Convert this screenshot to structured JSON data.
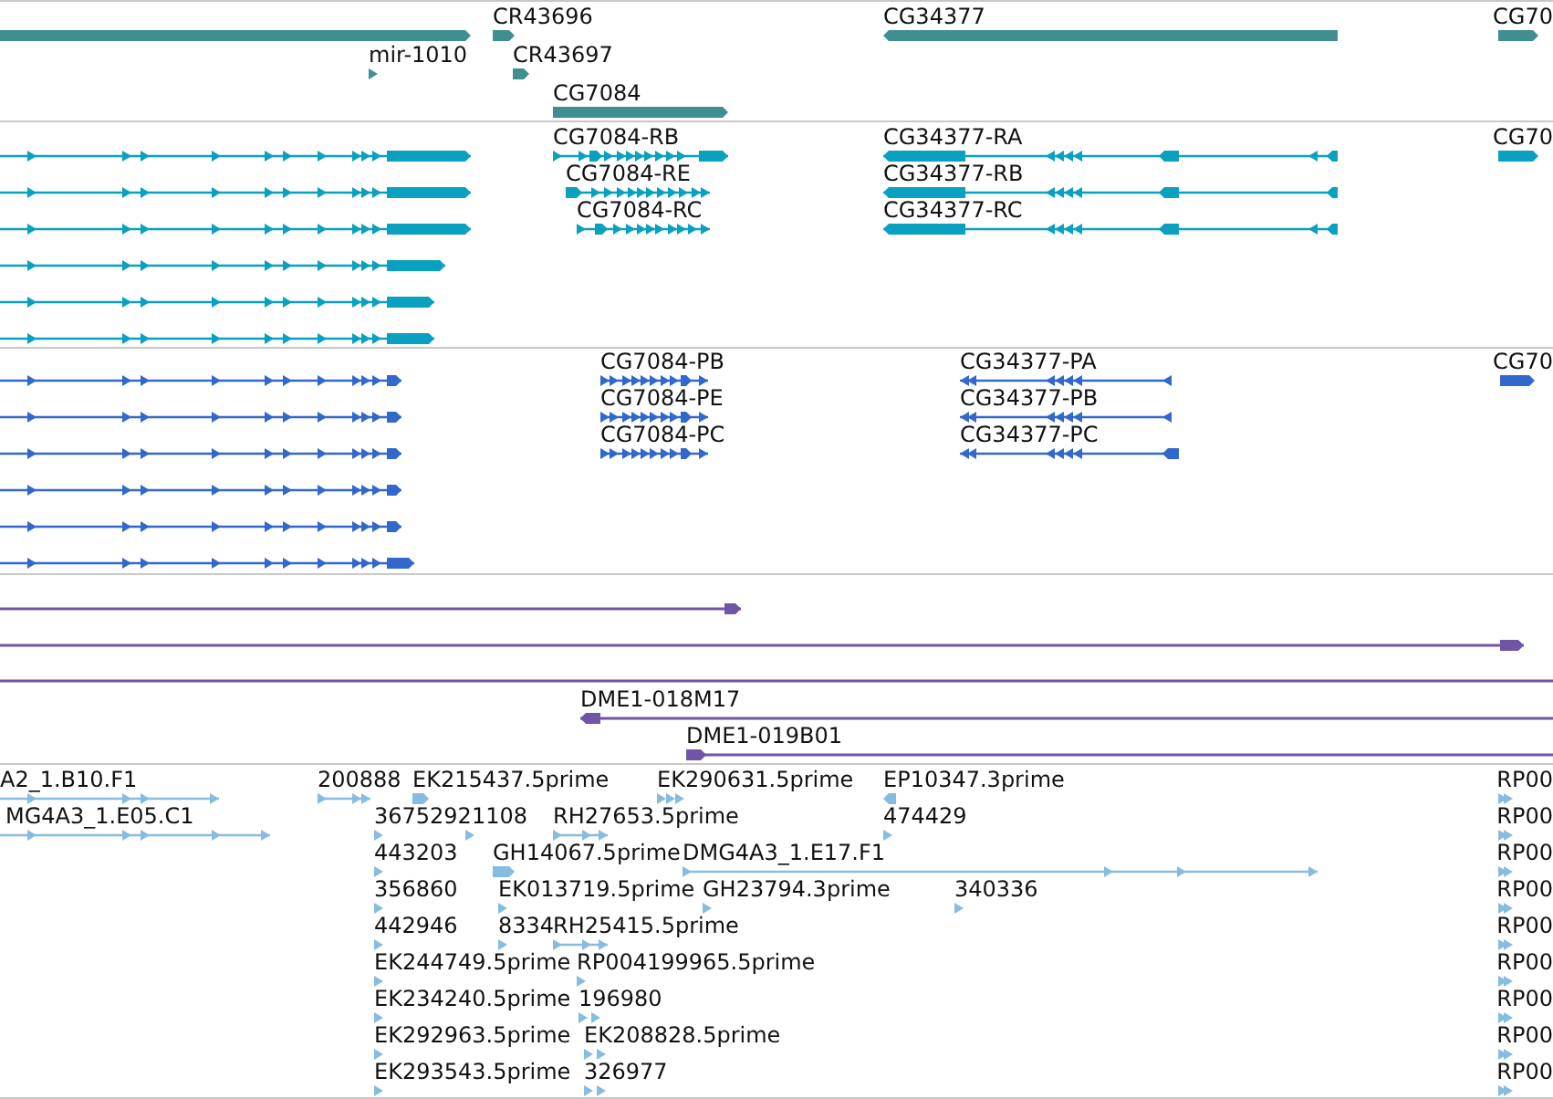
{
  "tracks": [
    {
      "kind": "gene",
      "features": [
        {
          "reverse": false
        },
        {
          "label": "CR43696",
          "reverse": false
        },
        {
          "label": "CG34377",
          "reverse": true
        },
        {
          "label": "CG70",
          "reverse": false
        },
        {
          "label": "mir-1010",
          "reverse": false
        },
        {
          "label": "CR43697",
          "reverse": false
        },
        {
          "label": "CG7084",
          "reverse": false
        }
      ]
    },
    {
      "kind": "transcript",
      "features": [
        {
          "reverse": false
        },
        {
          "label": "CG7084-RB",
          "reverse": false
        },
        {
          "label": "CG34377-RA",
          "reverse": true
        },
        {
          "label": "CG70",
          "reverse": false
        },
        {
          "reverse": false
        },
        {
          "label": "CG7084-RE",
          "reverse": false
        },
        {
          "label": "CG34377-RB",
          "reverse": true
        },
        {
          "reverse": false
        },
        {
          "label": "CG7084-RC",
          "reverse": false
        },
        {
          "label": "CG34377-RC",
          "reverse": true
        },
        {
          "reverse": false
        },
        {
          "reverse": false
        },
        {
          "reverse": false
        }
      ]
    },
    {
      "kind": "protein",
      "features": [
        {
          "reverse": false
        },
        {
          "label": "CG7084-PB",
          "reverse": false
        },
        {
          "label": "CG34377-PA",
          "reverse": true
        },
        {
          "label": "CG70",
          "reverse": false
        },
        {
          "reverse": false
        },
        {
          "label": "CG7084-PE",
          "reverse": false
        },
        {
          "label": "CG34377-PB",
          "reverse": true
        },
        {
          "reverse": false
        },
        {
          "label": "CG7084-PC",
          "reverse": false
        },
        {
          "label": "CG34377-PC",
          "reverse": true
        },
        {
          "reverse": false
        },
        {
          "reverse": false
        },
        {
          "reverse": false
        }
      ]
    },
    {
      "kind": "clone",
      "features": [
        {
          "kind": "arrow",
          "reverse": false
        },
        {
          "kind": "arrow",
          "reverse": false
        },
        {
          "kind": "span"
        },
        {
          "kind": "arrow",
          "label": "DME1-018M17",
          "reverse": true
        },
        {
          "kind": "arrow",
          "label": "DME1-019B01",
          "reverse": false
        }
      ]
    },
    {
      "kind": "est",
      "features": [
        {
          "label": "A2_1.B10.F1",
          "reverse": false
        },
        {
          "label": "200888",
          "reverse": false
        },
        {
          "label": "EK215437.5prime",
          "reverse": false
        },
        {
          "label": "EK290631.5prime",
          "reverse": false
        },
        {
          "label": "EP10347.3prime",
          "reverse": true
        },
        {
          "label": "RP00",
          "reverse": false
        },
        {
          "label": "MG4A3_1.E05.C1",
          "reverse": false
        },
        {
          "label": "36752921108",
          "reverse": false
        },
        {
          "reverse": false
        },
        {
          "label": "RH27653.5prime",
          "reverse": false
        },
        {
          "label": "474429",
          "reverse": false
        },
        {
          "label": "RP00",
          "reverse": false
        },
        {
          "label": "443203",
          "reverse": false
        },
        {
          "label": "GH14067.5prime",
          "reverse": false
        },
        {
          "label": "DMG4A3_1.E17.F1",
          "reverse": false
        },
        {
          "label": "RP00",
          "reverse": false
        },
        {
          "label": "356860",
          "reverse": false
        },
        {
          "label": "EK013719.5prime",
          "reverse": false
        },
        {
          "label": "GH23794.3prime",
          "reverse": false
        },
        {
          "label": "340336",
          "reverse": false
        },
        {
          "label": "RP00",
          "reverse": false
        },
        {
          "label": "442946",
          "reverse": false
        },
        {
          "label": "8334",
          "reverse": false
        },
        {
          "label": "RH25415.5prime",
          "reverse": false
        },
        {
          "label": "RP00",
          "reverse": false
        },
        {
          "label": "EK244749.5prime",
          "reverse": false
        },
        {
          "label": "RP004199965.5prime",
          "reverse": false
        },
        {
          "label": "RP00",
          "reverse": false
        },
        {
          "label": "EK234240.5prime",
          "reverse": false
        },
        {
          "label": "196980",
          "reverse": false
        },
        {
          "label": "RP00",
          "reverse": false
        },
        {
          "label": "EK292963.5prime",
          "reverse": false
        },
        {
          "label": "EK208828.5prime",
          "reverse": false
        },
        {
          "label": "RP00",
          "reverse": false
        },
        {
          "label": "EK293543.5prime",
          "reverse": false
        },
        {
          "label": "326977",
          "reverse": false
        },
        {
          "label": "RP00",
          "reverse": false
        }
      ]
    }
  ]
}
